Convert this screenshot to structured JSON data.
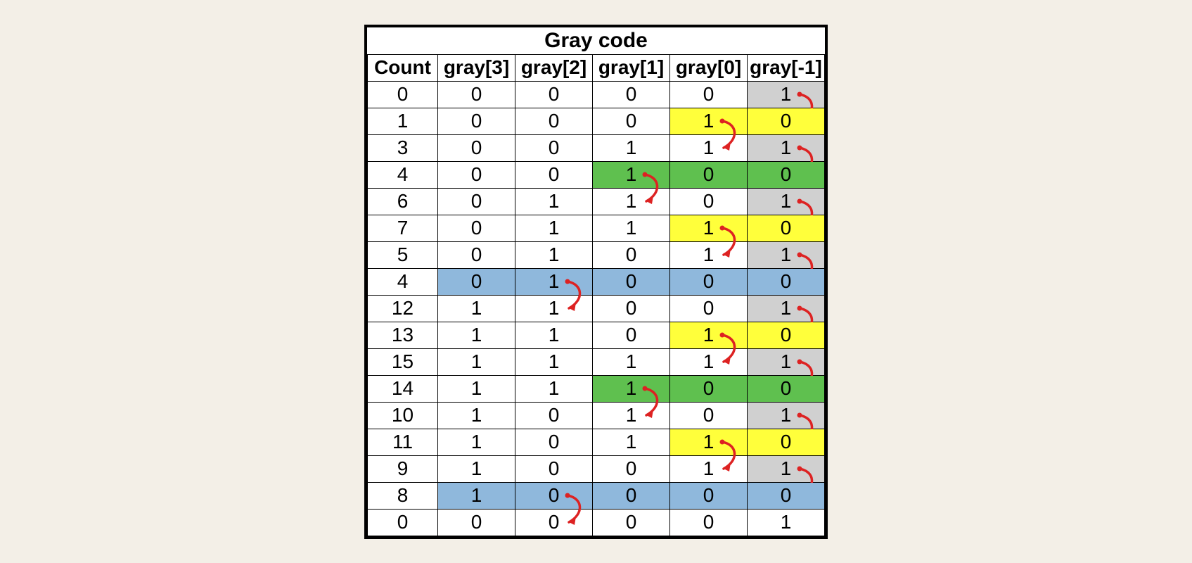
{
  "title": "Gray code",
  "headers": [
    "Count",
    "gray[3]",
    "gray[2]",
    "gray[1]",
    "gray[0]",
    "gray[-1]"
  ],
  "colors": {
    "grey": "#d0d0d0",
    "yellow": "#ffff3b",
    "green": "#5fc04f",
    "blue": "#8fb8dc"
  },
  "chart_data": {
    "type": "table",
    "columns": [
      "Count",
      "gray[3]",
      "gray[2]",
      "gray[1]",
      "gray[0]",
      "gray[-1]"
    ],
    "rows": [
      {
        "cells": [
          "0",
          "0",
          "0",
          "0",
          "0",
          "1"
        ],
        "fill": [
          "",
          "",
          "",
          "",
          "",
          "grey"
        ],
        "arrow": {
          "from": 4,
          "to": 4
        }
      },
      {
        "cells": [
          "1",
          "0",
          "0",
          "0",
          "1",
          "0"
        ],
        "fill": [
          "",
          "",
          "",
          "",
          "yellow",
          "yellow"
        ],
        "arrow": {
          "from": 3,
          "to": 3
        }
      },
      {
        "cells": [
          "3",
          "0",
          "0",
          "1",
          "1",
          "1"
        ],
        "fill": [
          "",
          "",
          "",
          "",
          "",
          "grey"
        ],
        "arrow": {
          "from": 4,
          "to": 4
        }
      },
      {
        "cells": [
          "4",
          "0",
          "0",
          "1",
          "0",
          "0"
        ],
        "fill": [
          "",
          "",
          "",
          "green",
          "green",
          "green"
        ],
        "arrow": {
          "from": 2,
          "to": 2
        }
      },
      {
        "cells": [
          "6",
          "0",
          "1",
          "1",
          "0",
          "1"
        ],
        "fill": [
          "",
          "",
          "",
          "",
          "",
          "grey"
        ],
        "arrow": {
          "from": 4,
          "to": 4
        }
      },
      {
        "cells": [
          "7",
          "0",
          "1",
          "1",
          "1",
          "0"
        ],
        "fill": [
          "",
          "",
          "",
          "",
          "yellow",
          "yellow"
        ],
        "arrow": {
          "from": 3,
          "to": 3
        }
      },
      {
        "cells": [
          "5",
          "0",
          "1",
          "0",
          "1",
          "1"
        ],
        "fill": [
          "",
          "",
          "",
          "",
          "",
          "grey"
        ],
        "arrow": {
          "from": 4,
          "to": 4
        }
      },
      {
        "cells": [
          "4",
          "0",
          "1",
          "0",
          "0",
          "0"
        ],
        "fill": [
          "",
          "blue",
          "blue",
          "blue",
          "blue",
          "blue"
        ],
        "arrow": {
          "from": 1,
          "to": 1
        }
      },
      {
        "cells": [
          "12",
          "1",
          "1",
          "0",
          "0",
          "1"
        ],
        "fill": [
          "",
          "",
          "",
          "",
          "",
          "grey"
        ],
        "arrow": {
          "from": 4,
          "to": 4
        }
      },
      {
        "cells": [
          "13",
          "1",
          "1",
          "0",
          "1",
          "0"
        ],
        "fill": [
          "",
          "",
          "",
          "",
          "yellow",
          "yellow"
        ],
        "arrow": {
          "from": 3,
          "to": 3
        }
      },
      {
        "cells": [
          "15",
          "1",
          "1",
          "1",
          "1",
          "1"
        ],
        "fill": [
          "",
          "",
          "",
          "",
          "",
          "grey"
        ],
        "arrow": {
          "from": 4,
          "to": 4
        }
      },
      {
        "cells": [
          "14",
          "1",
          "1",
          "1",
          "0",
          "0"
        ],
        "fill": [
          "",
          "",
          "",
          "green",
          "green",
          "green"
        ],
        "arrow": {
          "from": 2,
          "to": 2
        }
      },
      {
        "cells": [
          "10",
          "1",
          "0",
          "1",
          "0",
          "1"
        ],
        "fill": [
          "",
          "",
          "",
          "",
          "",
          "grey"
        ],
        "arrow": {
          "from": 4,
          "to": 4
        }
      },
      {
        "cells": [
          "11",
          "1",
          "0",
          "1",
          "1",
          "0"
        ],
        "fill": [
          "",
          "",
          "",
          "",
          "yellow",
          "yellow"
        ],
        "arrow": {
          "from": 3,
          "to": 3
        }
      },
      {
        "cells": [
          "9",
          "1",
          "0",
          "0",
          "1",
          "1"
        ],
        "fill": [
          "",
          "",
          "",
          "",
          "",
          "grey"
        ],
        "arrow": {
          "from": 4,
          "to": 4
        }
      },
      {
        "cells": [
          "8",
          "1",
          "0",
          "0",
          "0",
          "0"
        ],
        "fill": [
          "",
          "blue",
          "blue",
          "blue",
          "blue",
          "blue"
        ],
        "arrow": {
          "from": 1,
          "to": 1
        }
      },
      {
        "cells": [
          "0",
          "0",
          "0",
          "0",
          "0",
          "1"
        ],
        "fill": [
          "",
          "",
          "",
          "",
          "",
          ""
        ],
        "arrow": null
      }
    ]
  }
}
